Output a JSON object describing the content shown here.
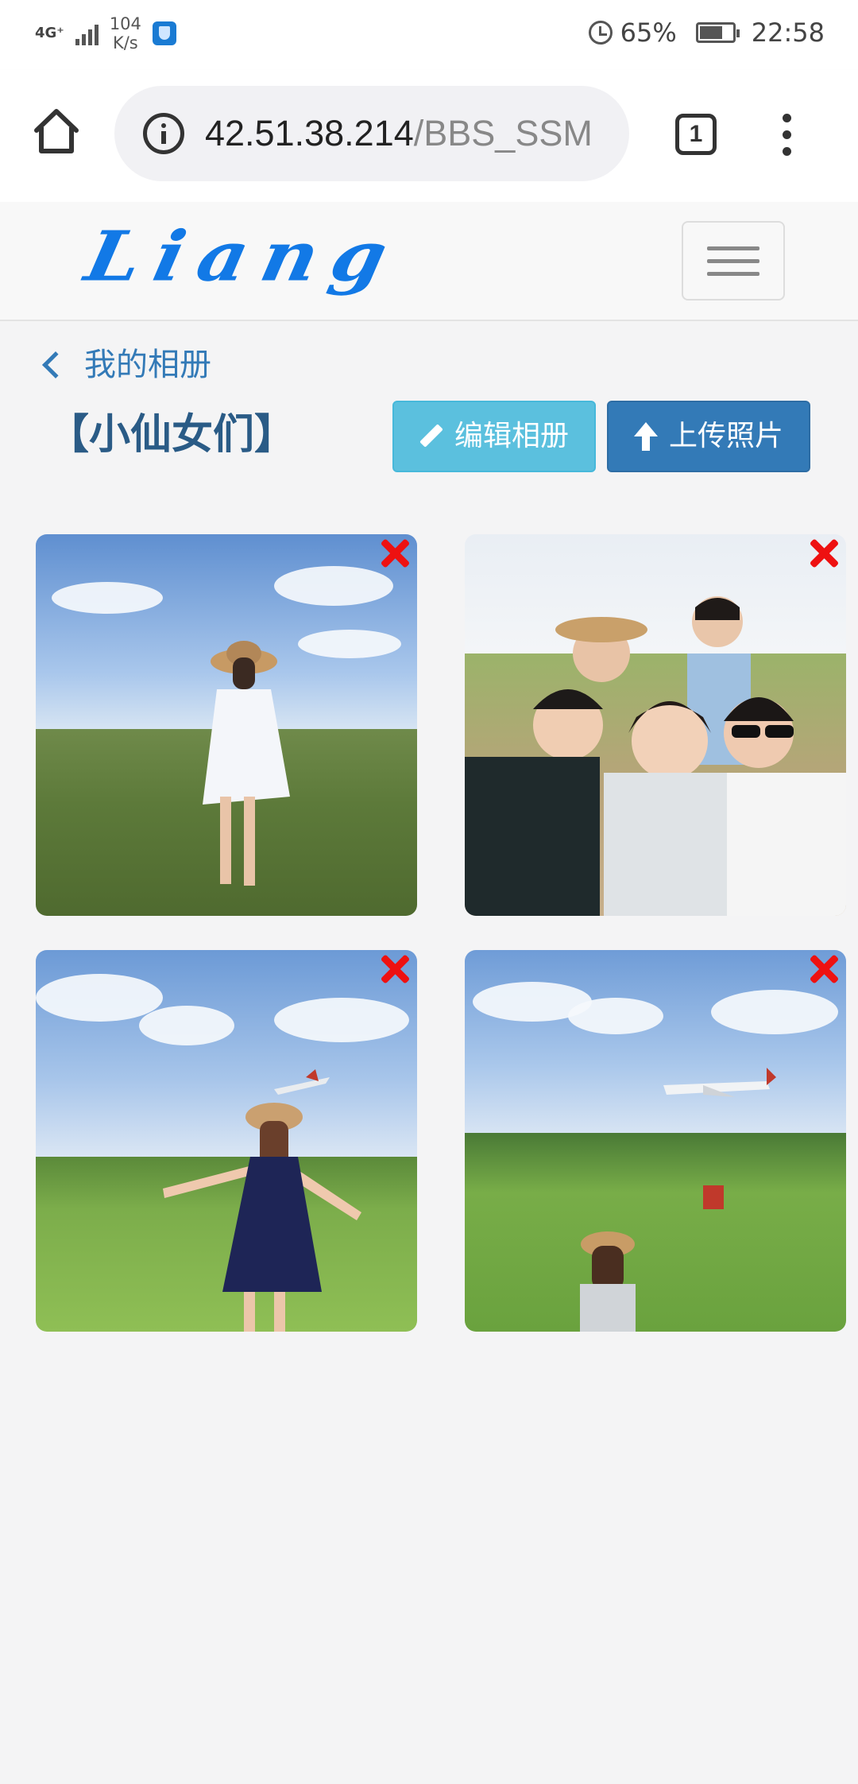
{
  "status_bar": {
    "network": "4G⁺",
    "speed_value": "104",
    "speed_unit": "K/s",
    "battery": "65%",
    "time": "22:58"
  },
  "browser": {
    "url_host": "42.51.38.214",
    "url_path": "/BBS_SSM",
    "tab_count": "1"
  },
  "site": {
    "logo_text": "Liang",
    "brand_color": "#1279e6"
  },
  "page": {
    "back_link": "我的相册",
    "album_title": "【小仙女们】",
    "edit_button": "编辑相册",
    "upload_button": "上传照片",
    "accent_color": "#337ab7",
    "info_color": "#5bc0de",
    "delete_color": "#ee1111"
  },
  "photos": [
    {
      "subject": "girl-in-white-dress-in-field",
      "delete_icon": "close-icon"
    },
    {
      "subject": "group-selfie",
      "delete_icon": "close-icon"
    },
    {
      "subject": "girl-waving-at-airplane",
      "delete_icon": "close-icon"
    },
    {
      "subject": "girl-watching-airplane-landing",
      "delete_icon": "close-icon"
    }
  ]
}
